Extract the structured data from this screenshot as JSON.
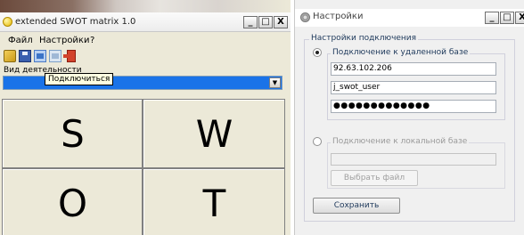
{
  "left_window": {
    "title": "extended SWOT matrix 1.0",
    "controls": {
      "minimize": "_",
      "maximize": "□",
      "close": "X"
    },
    "menu": [
      "Файл",
      "Настройки",
      "?"
    ],
    "toolbar": {
      "icons": [
        "open-folder-icon",
        "save-icon",
        "connect-icon",
        "disconnect-icon",
        "exit-icon"
      ]
    },
    "tooltip": "Подключиться",
    "activity_label": "Вид деятельности",
    "activity_combo_arrow": "▼",
    "swot": {
      "s": "S",
      "w": "W",
      "o": "O",
      "t": "T"
    }
  },
  "right_window": {
    "title": "Настройки",
    "controls": {
      "minimize": "_",
      "maximize": "□",
      "close": "X"
    },
    "group_title": "Настройки подключения",
    "remote": {
      "label": "Подключение к удаленной базе",
      "selected": true,
      "host": "92.63.102.206",
      "user": "j_swot_user",
      "password_mask": "●●●●●●●●●●●●●"
    },
    "local": {
      "label": "Подключение к локальной базе",
      "selected": false,
      "path": "",
      "choose_button": "Выбрать файл"
    },
    "save_button": "Сохранить"
  }
}
